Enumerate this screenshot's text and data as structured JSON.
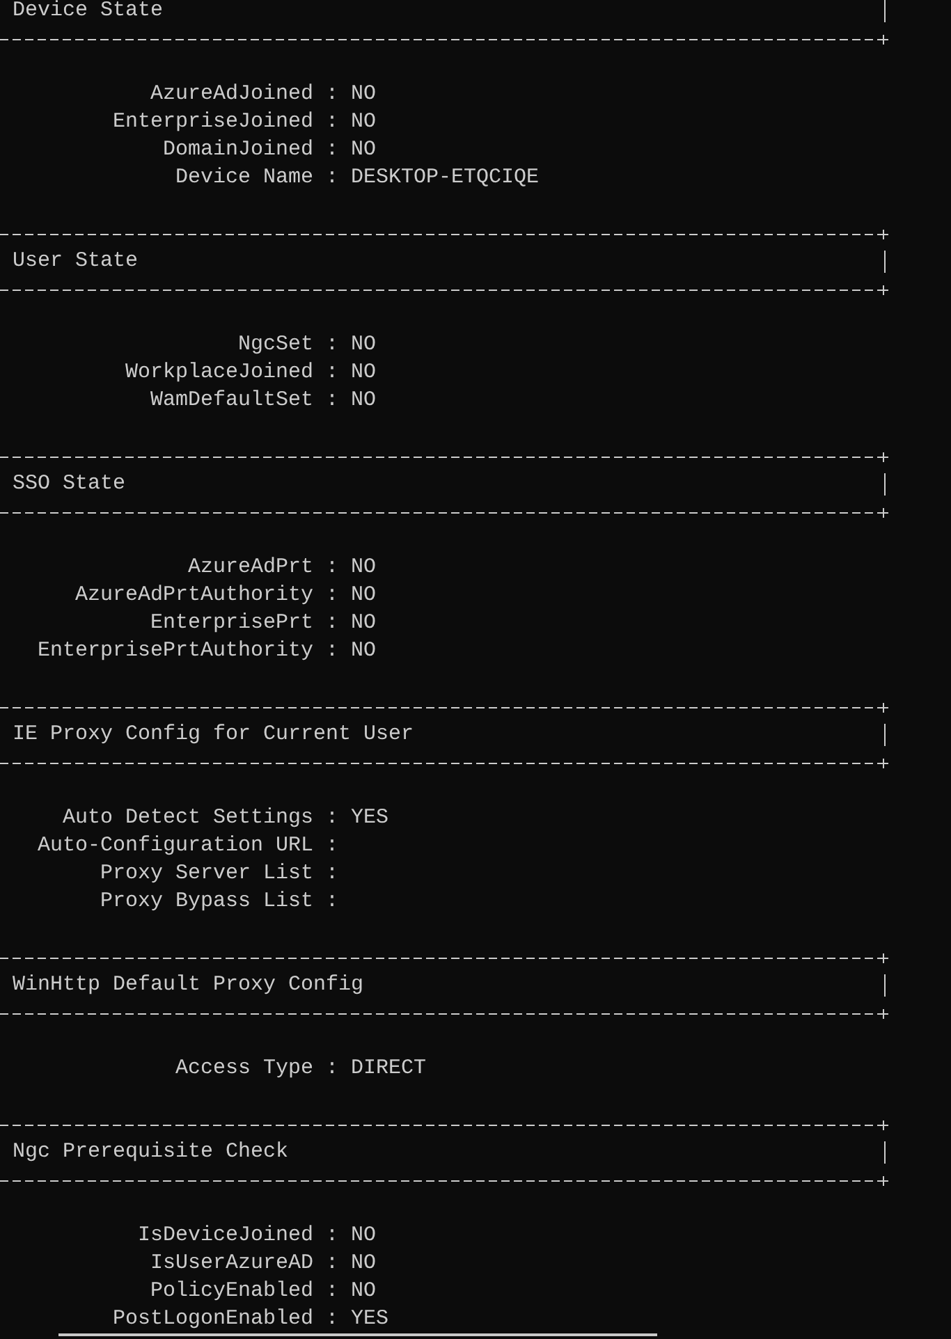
{
  "separator": ":",
  "sections": [
    {
      "title": "Device State",
      "entries": [
        {
          "key": "AzureAdJoined",
          "value": "NO"
        },
        {
          "key": "EnterpriseJoined",
          "value": "NO"
        },
        {
          "key": "DomainJoined",
          "value": "NO"
        },
        {
          "key": "Device Name",
          "value": "DESKTOP-ETQCIQE"
        }
      ]
    },
    {
      "title": "User State",
      "entries": [
        {
          "key": "NgcSet",
          "value": "NO"
        },
        {
          "key": "WorkplaceJoined",
          "value": "NO"
        },
        {
          "key": "WamDefaultSet",
          "value": "NO"
        }
      ]
    },
    {
      "title": "SSO State",
      "entries": [
        {
          "key": "AzureAdPrt",
          "value": "NO"
        },
        {
          "key": "AzureAdPrtAuthority",
          "value": "NO"
        },
        {
          "key": "EnterprisePrt",
          "value": "NO"
        },
        {
          "key": "EnterprisePrtAuthority",
          "value": "NO"
        }
      ]
    },
    {
      "title": "IE Proxy Config for Current User",
      "entries": [
        {
          "key": "Auto Detect Settings",
          "value": "YES"
        },
        {
          "key": "Auto-Configuration URL"
        },
        {
          "key": "Proxy Server List"
        },
        {
          "key": "Proxy Bypass List"
        }
      ]
    },
    {
      "title": "WinHttp Default Proxy Config",
      "entries": [
        {
          "key": "Access Type",
          "value": "DIRECT"
        }
      ]
    },
    {
      "title": "Ngc Prerequisite Check",
      "entries": [
        {
          "key": "IsDeviceJoined",
          "value": "NO"
        },
        {
          "key": "IsUserAzureAD",
          "value": "NO"
        },
        {
          "key": "PolicyEnabled",
          "value": "NO"
        },
        {
          "key": "PostLogonEnabled",
          "value": "YES"
        }
      ]
    }
  ]
}
